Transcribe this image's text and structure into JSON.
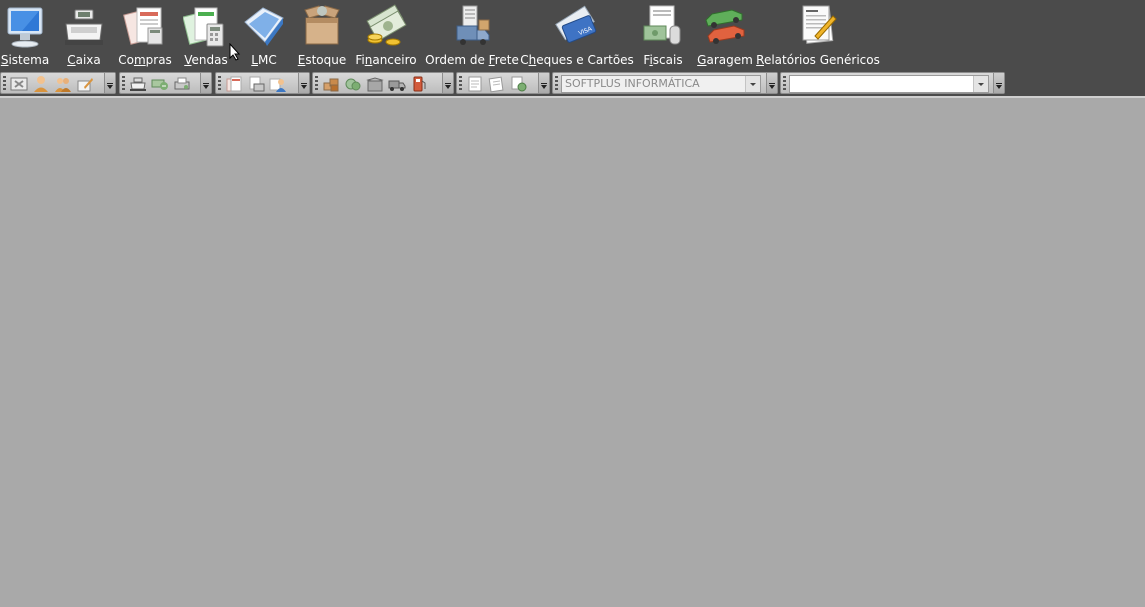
{
  "menu": {
    "items": [
      {
        "pre": "",
        "key": "S",
        "post": "istema",
        "icon": "computer-monitor-icon"
      },
      {
        "pre": "",
        "key": "C",
        "post": "aixa",
        "icon": "cash-register-icon"
      },
      {
        "pre": "Co",
        "key": "m",
        "post": "pras",
        "icon": "purchase-documents-icon"
      },
      {
        "pre": "",
        "key": "V",
        "post": "endas",
        "icon": "sales-calculator-icon"
      },
      {
        "pre": "",
        "key": "L",
        "post": "MC",
        "icon": "lmc-book-icon"
      },
      {
        "pre": "",
        "key": "E",
        "post": "stoque",
        "icon": "stock-box-icon"
      },
      {
        "pre": "Fi",
        "key": "n",
        "post": "anceiro",
        "icon": "money-coins-icon"
      },
      {
        "pre": "Ordem de ",
        "key": "F",
        "post": "rete",
        "icon": "freight-truck-icon"
      },
      {
        "pre": "C",
        "key": "h",
        "post": "eques e Cartões",
        "icon": "credit-card-icon"
      },
      {
        "pre": "F",
        "key": "i",
        "post": "scais",
        "icon": "fiscal-documents-icon"
      },
      {
        "pre": "",
        "key": "G",
        "post": "aragem",
        "icon": "garage-cars-icon"
      },
      {
        "pre": "",
        "key": "R",
        "post": "elatórios Genéricos",
        "icon": "reports-document-icon"
      }
    ]
  },
  "toolbar": {
    "company_combo": {
      "value": "SOFTPLUS INFORMÁTICA"
    },
    "search_combo": {
      "value": ""
    }
  },
  "colors": {
    "menubar_bg": "#4b4b4b",
    "workspace_bg": "#a9a9a9",
    "menu_text": "#ffffff"
  }
}
